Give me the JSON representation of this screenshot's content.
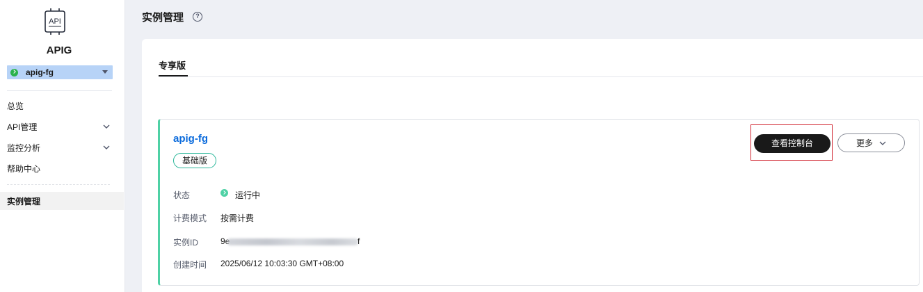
{
  "sidebar": {
    "logo_text": "API",
    "brand": "APIG",
    "instance_selector": {
      "value": "apig-fg",
      "status_color": "#2bb24c"
    },
    "nav": [
      {
        "label": "总览",
        "expandable": false,
        "active": false
      },
      {
        "label": "API管理",
        "expandable": true,
        "active": false
      },
      {
        "label": "监控分析",
        "expandable": true,
        "active": false
      },
      {
        "label": "帮助中心",
        "expandable": false,
        "active": false
      },
      {
        "label": "实例管理",
        "expandable": false,
        "active": true
      }
    ]
  },
  "header": {
    "title": "实例管理",
    "help_icon": "question-circle-icon"
  },
  "tabs": [
    {
      "label": "专享版",
      "selected": true
    }
  ],
  "instance_card": {
    "name": "apig-fg",
    "edition": "基础版",
    "accent_color": "#4fd1a5",
    "actions": {
      "console": "查看控制台",
      "more": "更多"
    },
    "details": {
      "status_label": "状态",
      "status_value": "运行中",
      "billing_label": "计费模式",
      "billing_value": "按需计费",
      "id_label": "实例ID",
      "id_prefix": "9e",
      "id_suffix": "f",
      "created_label": "创建时间",
      "created_value": "2025/06/12 10:03:30 GMT+08:00"
    }
  },
  "colors": {
    "link": "#0b6bdc",
    "primary_button": "#191919",
    "highlight": "#d0242f",
    "sidebar_select": "#b7d3f7"
  }
}
